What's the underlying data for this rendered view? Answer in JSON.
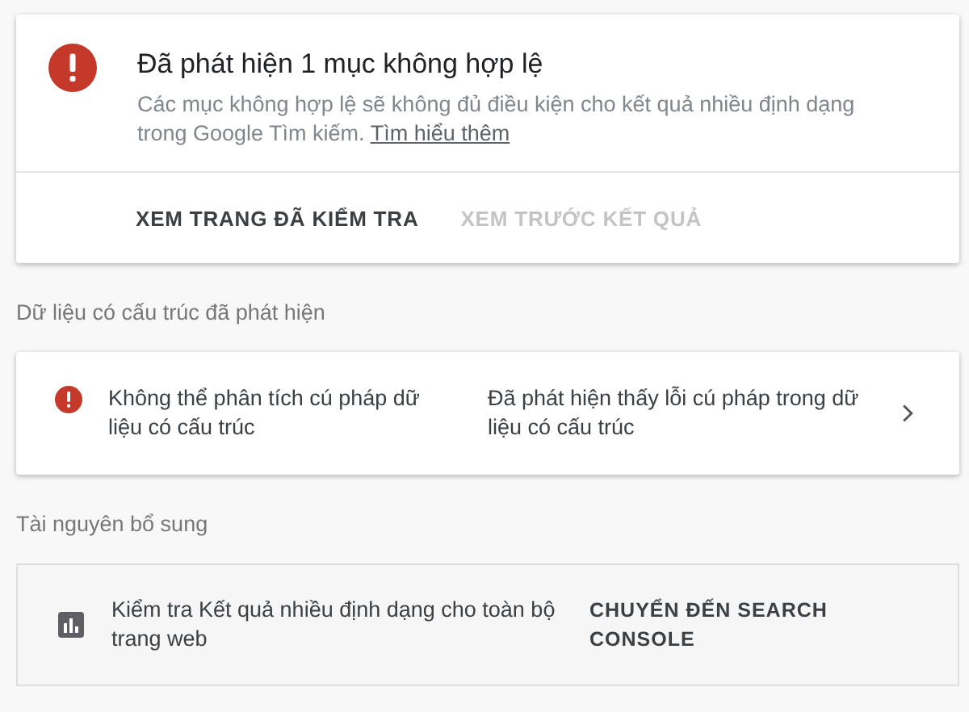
{
  "alert": {
    "title": "Đã phát hiện 1 mục không hợp lệ",
    "description": "Các mục không hợp lệ sẽ không đủ điều kiện cho kết quả nhiều định dạng trong Google Tìm kiếm.",
    "link": "Tìm hiểu thêm",
    "actions": [
      {
        "label": "XEM TRANG ĐÃ KIỂM TRA",
        "disabled": false
      },
      {
        "label": "XEM TRƯỚC KẾT QUẢ",
        "disabled": true
      }
    ]
  },
  "sections": [
    {
      "heading": "Dữ liệu có cấu trúc đã phát hiện",
      "kind": "issue",
      "text": "Không thể phân tích cú pháp dữ liệu có cấu trúc",
      "detail": "Đã phát hiện thấy lỗi cú pháp trong dữ liệu có cấu trúc"
    },
    {
      "heading": "Tài nguyên bổ sung",
      "kind": "resource",
      "text": "Kiểm tra Kết quả nhiều định dạng cho toàn bộ trang web",
      "action": "CHUYỂN ĐẾN SEARCH CONSOLE"
    }
  ]
}
